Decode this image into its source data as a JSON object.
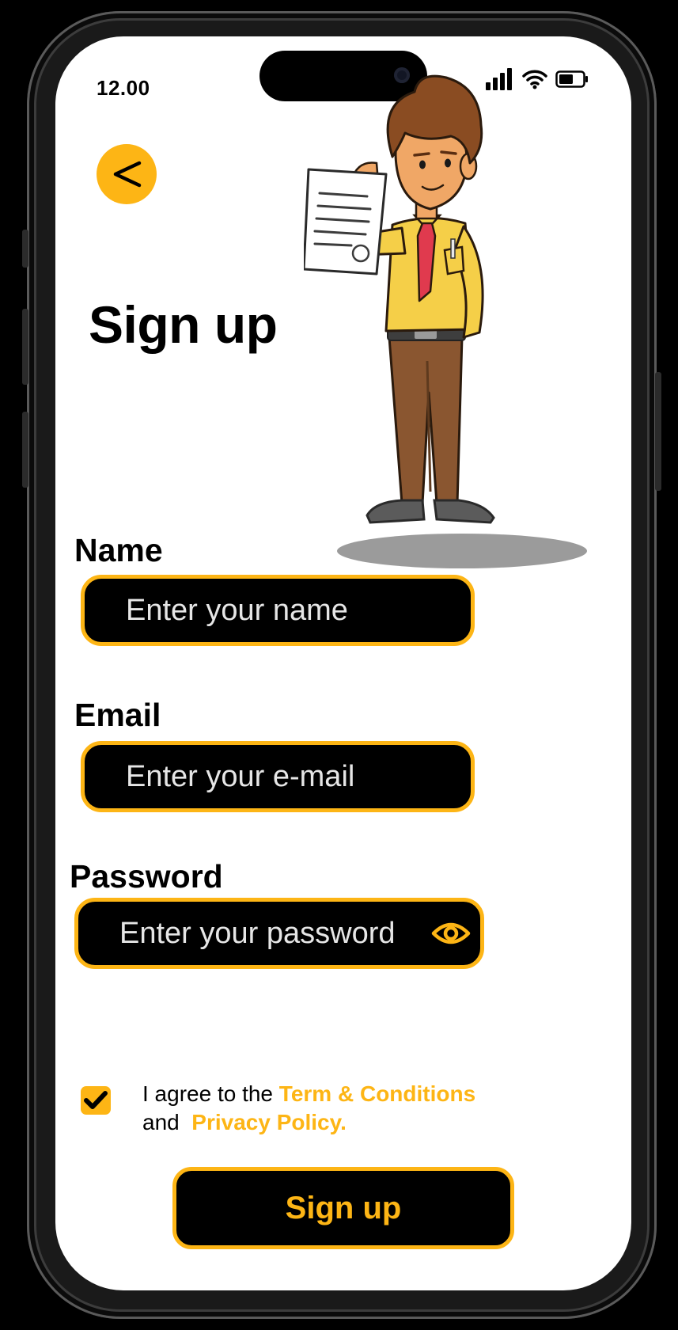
{
  "status_bar": {
    "time": "12.00"
  },
  "back_button": {
    "icon": "chevron-left-icon"
  },
  "page_title": "Sign up",
  "illustration": "man-holding-document-illustration",
  "form": {
    "name": {
      "label": "Name",
      "placeholder": "Enter your name"
    },
    "email": {
      "label": "Email",
      "placeholder": "Enter your e-mail"
    },
    "password": {
      "label": "Password",
      "placeholder": "Enter your password",
      "toggle_icon": "eye-icon"
    }
  },
  "agreement": {
    "checked": true,
    "text_prefix": "I agree to the",
    "terms_link": "Term & Conditions",
    "and_text": "and",
    "privacy_link": "Privacy Policy."
  },
  "submit_label": "Sign up",
  "colors": {
    "accent": "#FDB515",
    "field_bg": "#000000",
    "screen_bg": "#FFFFFF"
  }
}
